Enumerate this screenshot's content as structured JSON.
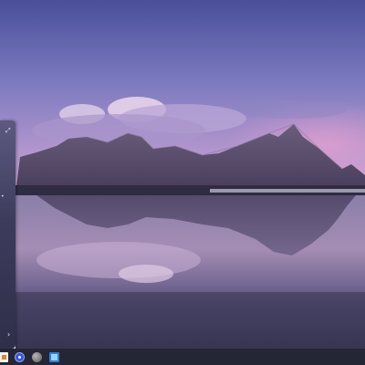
{
  "desktop": {
    "wallpaper": {
      "subject": "mountains-reflected-on-beach",
      "colors": {
        "sky_top": "#5257a3",
        "sky_mid": "#8b86c7",
        "sky_horizon": "#c9a7d6",
        "mountain": "#5a4d6e",
        "water": "#7a7298",
        "sand": "#2b2a3f"
      }
    }
  },
  "side_panel": {
    "expand_icon": "expand-icon",
    "chevron_icon": "chevron-right-icon",
    "colors": {
      "background": "#3c3b5c"
    }
  },
  "taskbar": {
    "icons": [
      {
        "name": "file-explorer-icon",
        "color": "#d98a2b"
      },
      {
        "name": "settings-icon",
        "color": "#3a56d8"
      },
      {
        "name": "globe-icon",
        "color": "#7a7a7a"
      },
      {
        "name": "window-icon",
        "color": "#2f7fd6"
      }
    ],
    "colors": {
      "background": "#121424"
    }
  }
}
